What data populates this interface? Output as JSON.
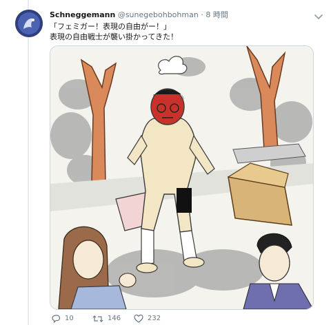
{
  "tweet": {
    "display_name": "Schneggemann",
    "handle": "@sunegebohbohman",
    "separator": "·",
    "time": "8 時間",
    "text_lines": [
      "「フェミガー！表現の自由がー！」",
      "表現の自由戦士が襲い掛かってきた！"
    ],
    "media": {
      "type": "illustration",
      "colors": {
        "tree": "#d9895a",
        "smoke": "#9a9a9a",
        "skin": "#f3e6c4",
        "face": "#c8322a",
        "box": "#d9b478",
        "woman_hair": "#9b6a4a",
        "man_suit": "#6f6fb0",
        "censor": "#111111"
      }
    },
    "actions": {
      "reply_count": "10",
      "retweet_count": "146",
      "like_count": "232"
    },
    "icons": {
      "avatar": "avatar",
      "menu": "chevron-down-icon",
      "reply": "reply-icon",
      "retweet": "retweet-icon",
      "like": "heart-icon"
    }
  }
}
